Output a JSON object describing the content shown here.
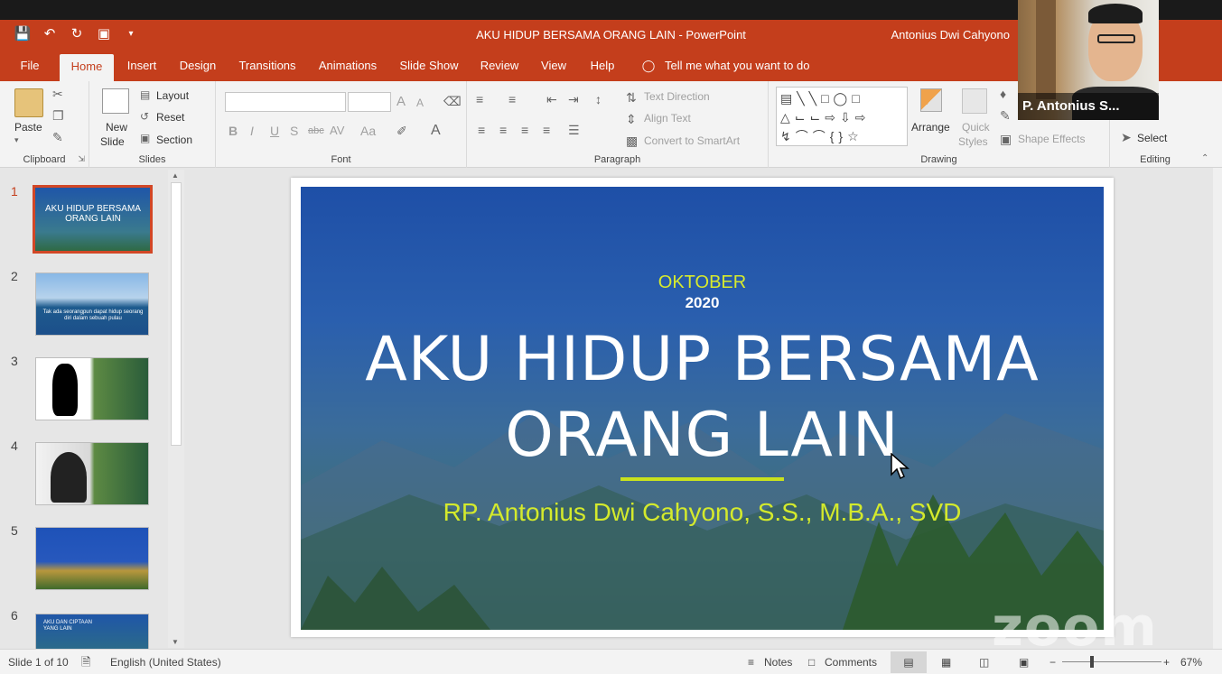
{
  "window": {
    "title": "AKU HIDUP BERSAMA ORANG LAIN  -  PowerPoint",
    "user": "Antonius Dwi Cahyono"
  },
  "quick_access": {
    "icons": [
      "save-icon",
      "undo-icon",
      "redo-icon",
      "present-icon",
      "customize-icon"
    ]
  },
  "tabs": [
    "File",
    "Home",
    "Insert",
    "Design",
    "Transitions",
    "Animations",
    "Slide Show",
    "Review",
    "View",
    "Help"
  ],
  "active_tab": "Home",
  "tell_me": "Tell me what you want to do",
  "ribbon": {
    "clipboard": {
      "paste": "Paste",
      "label": "Clipboard"
    },
    "slides": {
      "new_slide_1": "New",
      "new_slide_2": "Slide",
      "layout": "Layout",
      "reset": "Reset",
      "section": "Section",
      "label": "Slides"
    },
    "font": {
      "label": "Font",
      "bold": "B",
      "italic": "I",
      "underline": "U",
      "shadow": "S",
      "strike": "abc",
      "spacing": "AV",
      "case": "Aa",
      "grow": "A",
      "shrink": "A"
    },
    "paragraph": {
      "label": "Paragraph",
      "text_direction": "Text Direction",
      "align_text": "Align Text",
      "convert": "Convert to SmartArt"
    },
    "drawing": {
      "label": "Drawing",
      "arrange": "Arrange",
      "quick_styles_1": "Quick",
      "quick_styles_2": "Styles",
      "shape_effects": "Shape Effects"
    },
    "editing": {
      "label": "Editing",
      "select": "Select"
    }
  },
  "thumbnails": [
    {
      "num": "1",
      "title": "AKU HIDUP BERSAMA ORANG LAIN",
      "selected": true
    },
    {
      "num": "2",
      "caption": "Tak ada seorangpun dapat hidup seorang diri dalam sebuah pulau"
    },
    {
      "num": "3"
    },
    {
      "num": "4"
    },
    {
      "num": "5"
    },
    {
      "num": "6",
      "title": "AKU DAN CIPTAAN YANG LAIN"
    }
  ],
  "slide": {
    "month": "OKTOBER",
    "year": "2020",
    "title_line1": "AKU HIDUP BERSAMA",
    "title_line2": "ORANG LAIN",
    "author": "RP. Antonius Dwi Cahyono, S.S., M.B.A., SVD"
  },
  "status": {
    "slide_count": "Slide 1 of 10",
    "language": "English (United States)",
    "notes": "Notes",
    "comments": "Comments",
    "zoom": "67%"
  },
  "video": {
    "name": "P. Antonius S..."
  },
  "watermark": "zoom"
}
